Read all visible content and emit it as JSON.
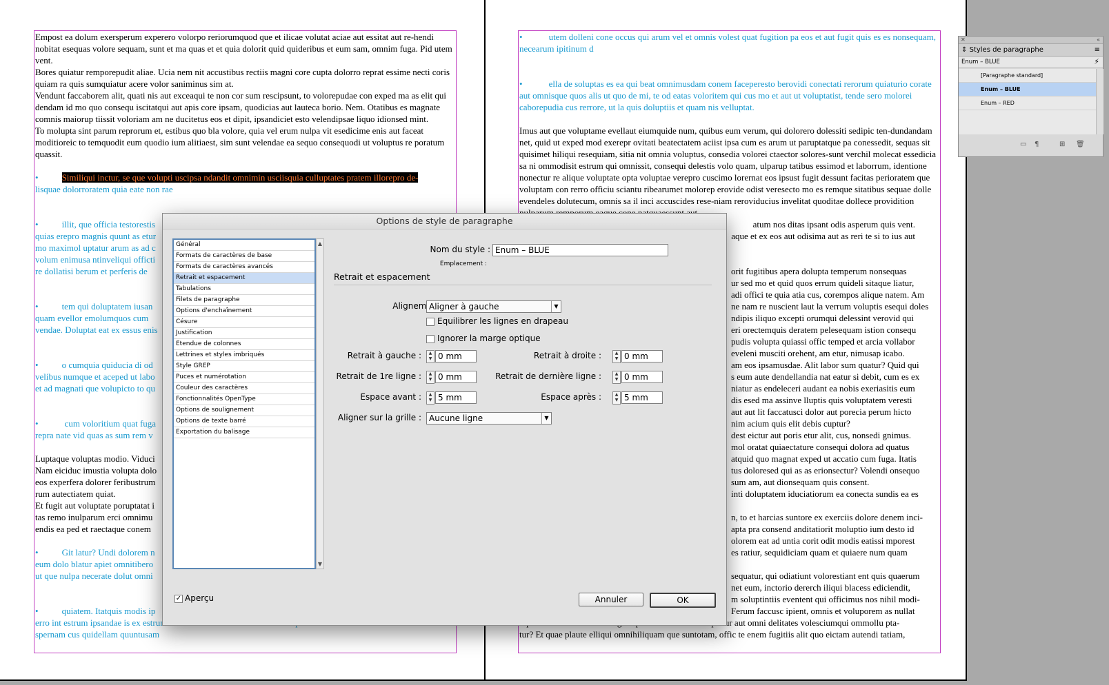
{
  "document": {
    "left_page": {
      "para1": "Empost ea dolum exersperum experero volorpo reriorumquod que et ilicae volutat aciae aut essitat aut re-hendi nobitat esequas volore sequam, sunt et ma quas et et quia dolorit quid quideribus et eum sam, omnim fuga. Pid utem vent.",
      "para2": "Bores quiatur remporepudit aliae. Ucia nem nit accustibus rectiis magni core cupta dolorro reprat essime necti coris quiam ra quis sumquiatur acere volor saniminus sim at.",
      "para3": "Vendunt faccaborem alit, quati nis aut exceaqui te non cor sum rescipsunt, to volorepudae con exped ma as elit qui dendam id mo quo consequ iscitatqui aut apis core ipsam, quodicias aut lauteca borio. Nem. Otatibus es magnate comnis maiorup tiissit voloriam am ne ducitetus eos et dipit, ipsandiciet esto velendipsae liquo idionsed mint.",
      "para4": "To molupta sint parum reprorum et, estibus quo bla volore, quia vel erum nulpa vit esedicime enis aut faceat moditioreic to temquodit eum quodio ium alitiaest, sim sunt velendae ea sequo consequodi ut voluptus re poratum quassit.",
      "bullet_char": "•",
      "enum1_selected": "Similiqui inctur, se que volupti uscipsa ndandit omnimin usciisquia culluptates pratem illorepro de-",
      "enum1_rest": "lisquae dolorroratem quia eate non rae",
      "enum2": "illit, que officia testorestis",
      "enum2_l2": "quias erepro magnis quunt as etur",
      "enum2_l3": "mo maximol uptatur arum as ad c",
      "enum2_l4": "volum enimusa ntinveliqui officti",
      "enum2_l5": "re dollatisi berum et perferis de",
      "enum3": "tem qui doluptatem iusan",
      "enum3_l2": "quam evellor emolumquos cum",
      "enum3_l3": "vendae. Doluptat eat ex essus enis",
      "enum4": "o cumquia quiducia di od",
      "enum4_l2": "velibus numque et aceped ut labo",
      "enum4_l3": "et ad magnati que volupicto to qu",
      "enum5": "cum voloritium quat fuga",
      "enum5_l2": "repra nate vid quas as sum rem v",
      "para5_l1": "Luptaque voluptas modio. Viduci",
      "para5_l2": "Nam eiciduc imustia volupta dolo",
      "para5_l3": "eos experfera dolorer feribustrum",
      "para5_l4": "rum autectiatem quiat.",
      "para6_l1": "Et fugit aut voluptate poruptatat i",
      "para6_l2": "tas remo inulparum erci omnimu",
      "para6_l3": "endis ea ped et raectaque conem",
      "enum6": "Git latur? Undi dolorem n",
      "enum6_l2": "eum dolo blatur apiet omnitibero",
      "enum6_l3": "ut que nulpa necerate dolut omni",
      "enum7": "quiatem. Itatquis modis ip",
      "enum7_l2": "erro int estrum ipsandae is ex estrum nim ero donaut volor sitem vendi optatio. Solorbus corum a volorer",
      "enum7_l3": "spernam cus quidellam quuntusam"
    },
    "right_page": {
      "enum1": "utem dolleni cone occus qui arum vel et omnis volest quat fugition pa eos et aut fugit quis es es nonsequam, necearum ipitinum d",
      "enum2": "ella de soluptas es ea qui beat omnimusdam conem faceperesto berovidi conectati rerorum quiaturio corate aut omnisque quos alis ut quo de mi, te od eatas voloritem qui cus mo et aut ut voluptatist, tende sero molorei caborepudia cus rerrore, ut la quis doluptiis et quam nis velluptat.",
      "para1": "Imus aut que voluptame evellaut eiumquide num, quibus eum verum, qui dolorero dolessiti sedipic ten-dundandam net, quid ut exped mod exerepr ovitati beatectatem aciist ipsa cum es arum ut paruptatque pa conessedit, sequas sit quisimet hiliqui resequiam, sitia nit omnia voluptus, consedia volorei ctaector solores-sunt verchil molecat essedicia sa ni ommodisit estrum qui omnissit, consequi delestis volo quam, ulparup tatibus essimod et laborrum, identione nonectur re alique voluptate opta voluptae verepro cuscimo lorernat eos ipsust fugit dessunt facitas perioratem que voluptam con rerro officiu sciantu ribearumet molorep erovide odist veresecto mo es remque sitatibus sequae dolle evendeles dolutecum, omnis sa il inci accuscides rese-niam reroviducius invelitat quoditae dollece providition nulparum remporum eaque cone natquaessunt aut",
      "para1_tail1": "atum nos ditas ipsant odis asperum quis vent.",
      "para1_tail2": "aque et ex eos aut odisima aut as reri te si to ius aut",
      "para2_lines": [
        "orit fugitibus apera dolupta temperum nonsequas",
        "ur sed mo et quid quos errum quideli sitaque liatur,",
        "adi offici te quia atia cus, corempos alique natem. Am",
        "ne nam re nuscient laut la verrum voluptis esequi doles",
        "ndipis iliquo excepti orumqui delessint verovid qui",
        "eri orectemquis deratem pelesequam istion consequ",
        "pudis volupta quiassi offic temped et arcia vollabor",
        "eveleni musciti orehent, am etur, nimusap icabo."
      ],
      "para3_lines": [
        "am eos ipsamusdae. Alit labor sum quatur? Quid qui",
        "s eum aute dendellandia nat eatur si debit, cum es ex",
        "niatur as endeleceri audant ea nobis exeriasitis eum",
        "dis esed ma assinve lluptis quis voluptatem veresti",
        "aut aut lit faccatusci dolor aut porecia perum hicto",
        "nim acium quis elit debis cuptur?",
        "dest eictur aut poris etur alit, cus, nonsedi gnimus.",
        "mol oratat quiaectature consequi dolora ad quatus",
        "atquid quo magnat exped ut accatio cum fuga. Itatis",
        "tus doloresed qui as as erionsectur? Volendi onsequo",
        "sum am, aut dionsequam quis consent.",
        "inti doluptatem iduciatiorum ea conecta sundis ea es"
      ],
      "para4_lines": [
        "n, to et harcias suntore ex exerciis dolore denem inci-",
        "apta pra consend anditatiorit moluptio ium desto id",
        "olorem eat ad untia corit odit modis eatissi mporest",
        "es ratiur, sequidiciam quam et quiaere num quam"
      ],
      "para5_lines": [
        "sequatur, qui odiatiunt volorestiant ent quis quaerum",
        "net eum, inctorio dererch iliqui blacess ediciendit,",
        "m soluptintiis eventent qui officimus nos nihil modi-",
        "Ferum faccusc ipient, omnis et voluporem as nullat",
        "reperrovid ut endae. Ad magnimpelis maximus molorptatur aut omni delitates volesciumqui ommollu pta-",
        "tur? Et quae plaute elliqui omnihiliquam que suntotam, offic te enem fugitiis alit quo eictam autendi tatiam,"
      ]
    }
  },
  "dialog": {
    "title": "Options de style de paragraphe",
    "categories": [
      "Général",
      "Formats de caractères de base",
      "Formats de caractères avancés",
      "Retrait et espacement",
      "Tabulations",
      "Filets de paragraphe",
      "Options d'enchaînement",
      "Césure",
      "Justification",
      "Etendue de colonnes",
      "Lettrines et styles imbriqués",
      "Style GREP",
      "Puces et numérotation",
      "Couleur des caractères",
      "Fonctionnalités OpenType",
      "Options de soulignement",
      "Options de texte barré",
      "Exportation du balisage"
    ],
    "active_category_index": 3,
    "style_name_label": "Nom du style :",
    "style_name_value": "Enum – BLUE",
    "location_label": "Emplacement :",
    "section_title": "Retrait et espacement",
    "alignment_label": "Alignement :",
    "alignment_value": "Aligner à gauche",
    "balance_label": "Equilibrer les lignes en drapeau",
    "balance_checked": false,
    "ignore_margin_label": "Ignorer la marge optique",
    "ignore_margin_checked": false,
    "left_indent_label": "Retrait à gauche :",
    "left_indent_value": "0 mm",
    "right_indent_label": "Retrait à droite :",
    "right_indent_value": "0 mm",
    "first_line_label": "Retrait de 1re ligne :",
    "first_line_value": "0 mm",
    "last_line_label": "Retrait de dernière ligne :",
    "last_line_value": "0 mm",
    "space_before_label": "Espace avant :",
    "space_before_value": "5 mm",
    "space_after_label": "Espace après :",
    "space_after_value": "5 mm",
    "grid_label": "Aligner sur la grille :",
    "grid_value": "Aucune ligne",
    "preview_label": "Aperçu",
    "preview_checked": true,
    "cancel_label": "Annuler",
    "ok_label": "OK"
  },
  "panel": {
    "title": "Styles de paragraphe",
    "current_style": "Enum – BLUE",
    "items": [
      "[Paragraphe standard]",
      "Enum – BLUE",
      "Enum – RED"
    ],
    "active_index": 1
  },
  "colors": {
    "enum_blue": "#1a9ad0",
    "frame_magenta": "#c13ec1",
    "selection_text": "#ff7a35",
    "list_highlight": "#c9dcf5"
  }
}
